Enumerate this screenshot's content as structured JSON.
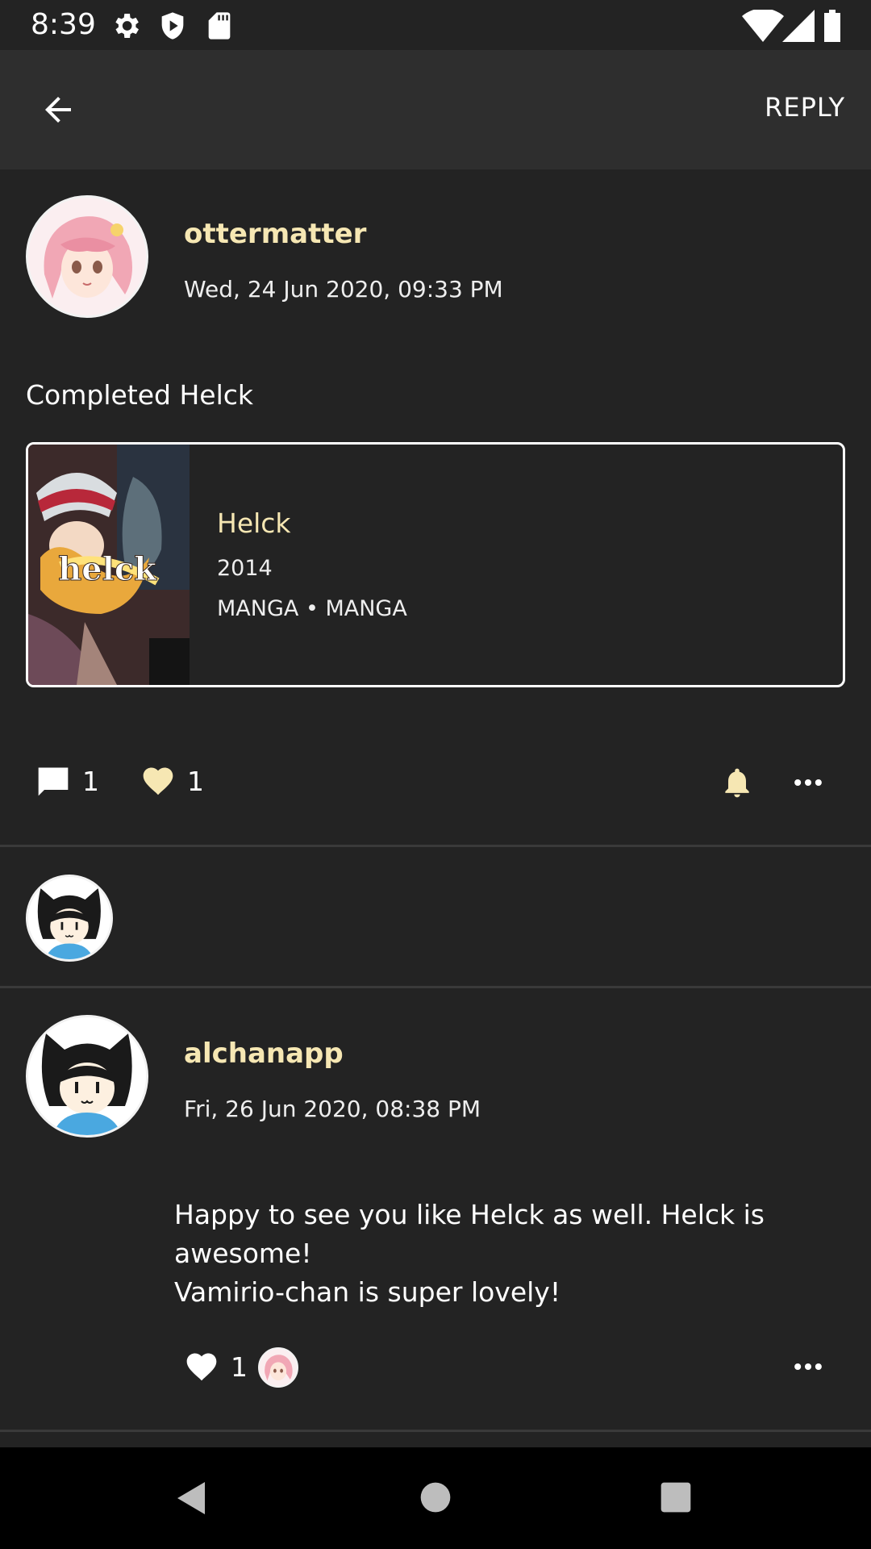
{
  "status_bar": {
    "time": "8:39",
    "icons": [
      "gear-icon",
      "shield-play-icon",
      "sd-card-icon",
      "wifi-icon",
      "signal-icon",
      "battery-icon"
    ]
  },
  "app_bar": {
    "back_icon": "arrow-left-icon",
    "reply_label": "REPLY"
  },
  "post": {
    "username": "ottermatter",
    "timestamp": "Wed, 24 Jun 2020, 09:33 PM",
    "text": "Completed Helck",
    "media": {
      "title": "Helck",
      "year": "2014",
      "type": "MANGA • MANGA",
      "cover_text": "helck"
    },
    "reply_count": "1",
    "like_count": "1",
    "icons": [
      "comment-icon",
      "heart-icon",
      "bell-icon",
      "more-icon"
    ]
  },
  "comment": {
    "username": "alchanapp",
    "timestamp": "Fri, 26 Jun 2020, 08:38 PM",
    "text_line1": "Happy to see you like Helck as well. Helck is awesome!",
    "text_line2": "Vamirio-chan is super lovely!",
    "like_count": "1"
  },
  "colors": {
    "background": "#232323",
    "appbar": "#2e2e2e",
    "accent": "#f6e7b3"
  }
}
